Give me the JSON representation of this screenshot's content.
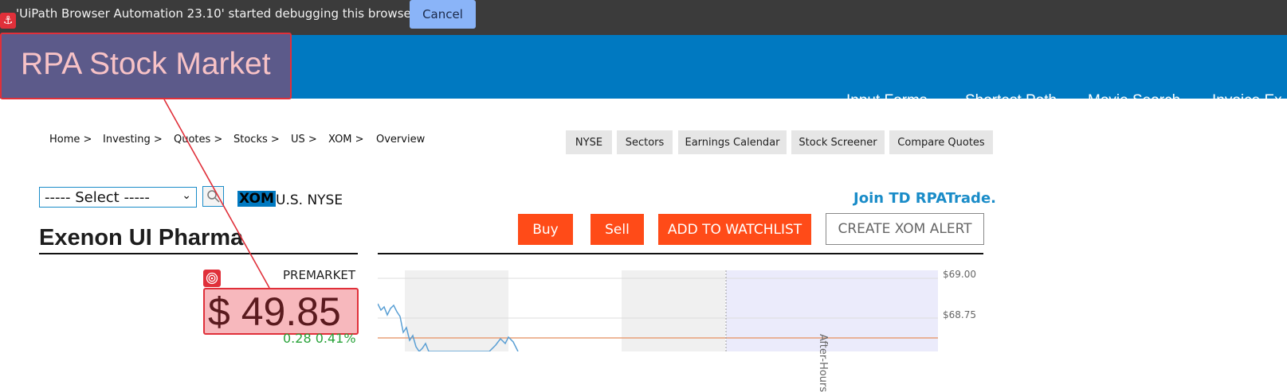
{
  "debug_bar": {
    "message": "'UiPath Browser Automation 23.10' started debugging this browser",
    "cancel_label": "Cancel"
  },
  "navbar": {
    "brand": "RPA Stock Market",
    "links": [
      "Input Forms",
      "Shortest Path",
      "Movie Search",
      "Invoice Ex"
    ]
  },
  "breadcrumb": [
    "Home >",
    "Investing >",
    "Quotes >",
    "Stocks >",
    "US >",
    "XOM >",
    "Overview"
  ],
  "quick_links": [
    "NYSE",
    "Sectors",
    "Earnings Calendar",
    "Stock Screener",
    "Compare Quotes"
  ],
  "symbol_search": {
    "select_value": "----- Select -----",
    "ticker": "XOM",
    "exchange": "U.S. NYSE"
  },
  "promo": "Join TD RPATrade.",
  "actions": {
    "buy": "Buy",
    "sell": "Sell",
    "watchlist": "ADD TO WATCHLIST",
    "alert": "CREATE XOM ALERT"
  },
  "company_name": "Exenon UI Pharma",
  "quote": {
    "session": "PREMARKET",
    "price": "$ 49.85",
    "change": "0.28 0.41%"
  },
  "chart": {
    "y_ticks": [
      "$69.00",
      "$68.75"
    ],
    "after_hours_label": "After-Hours",
    "colors": {
      "line": "#5a9fd4",
      "reference": "#e8a078",
      "after_hours_band": "#ebebfb",
      "session_band": "#f0f0f0"
    }
  },
  "colors": {
    "navbar": "#0079c1",
    "action": "#ff4b18",
    "highlight": "#e0303a"
  }
}
